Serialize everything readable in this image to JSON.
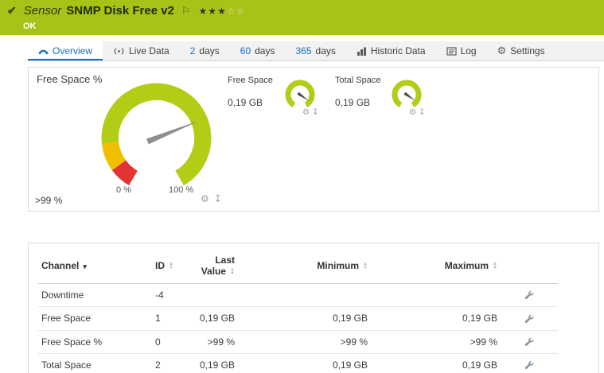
{
  "colors": {
    "banner_green": "#a9c217",
    "accent_blue": "#1a6ec0",
    "gauge_green": "#b3cc16",
    "gauge_yellow": "#f0c000",
    "gauge_red": "#e23434",
    "needle_gray": "#8f8f8f"
  },
  "icons": {
    "check": "✔",
    "flag": "⚐",
    "stars_filled": "★★★",
    "stars_empty": "☆☆",
    "gear": "⚙",
    "pin": "↧",
    "sort_up": "▲",
    "sort_down": "▼",
    "channel_sort_dropdown": "▾"
  },
  "header": {
    "kind": "Sensor",
    "title": "SNMP Disk Free v2",
    "status": "OK"
  },
  "tabs": [
    {
      "label": "Overview"
    },
    {
      "label": "Live Data"
    },
    {
      "value": "2",
      "unit": "days"
    },
    {
      "value": "60",
      "unit": "days"
    },
    {
      "value": "365",
      "unit": "days"
    },
    {
      "label": "Historic Data"
    },
    {
      "label": "Log"
    },
    {
      "label": "Settings"
    }
  ],
  "overview_panel": {
    "primary_gauge": {
      "title": "Free Space %",
      "value": ">99 %",
      "scale_start": "0 %",
      "scale_end": "100 %"
    },
    "mini_gauges": [
      {
        "title": "Free Space",
        "value": "0,19 GB"
      },
      {
        "title": "Total Space",
        "value": "0,19 GB"
      }
    ]
  },
  "channel_table": {
    "headers": {
      "channel": "Channel",
      "id": "ID",
      "last_value": "Last Value",
      "minimum": "Minimum",
      "maximum": "Maximum"
    },
    "rows": [
      {
        "channel": "Downtime",
        "id": "-4",
        "last_value": "",
        "minimum": "",
        "maximum": ""
      },
      {
        "channel": "Free Space",
        "id": "1",
        "last_value": "0,19 GB",
        "minimum": "0,19 GB",
        "maximum": "0,19 GB"
      },
      {
        "channel": "Free Space %",
        "id": "0",
        "last_value": ">99 %",
        "minimum": ">99 %",
        "maximum": ">99 %"
      },
      {
        "channel": "Total Space",
        "id": "2",
        "last_value": "0,19 GB",
        "minimum": "0,19 GB",
        "maximum": "0,19 GB"
      }
    ]
  }
}
